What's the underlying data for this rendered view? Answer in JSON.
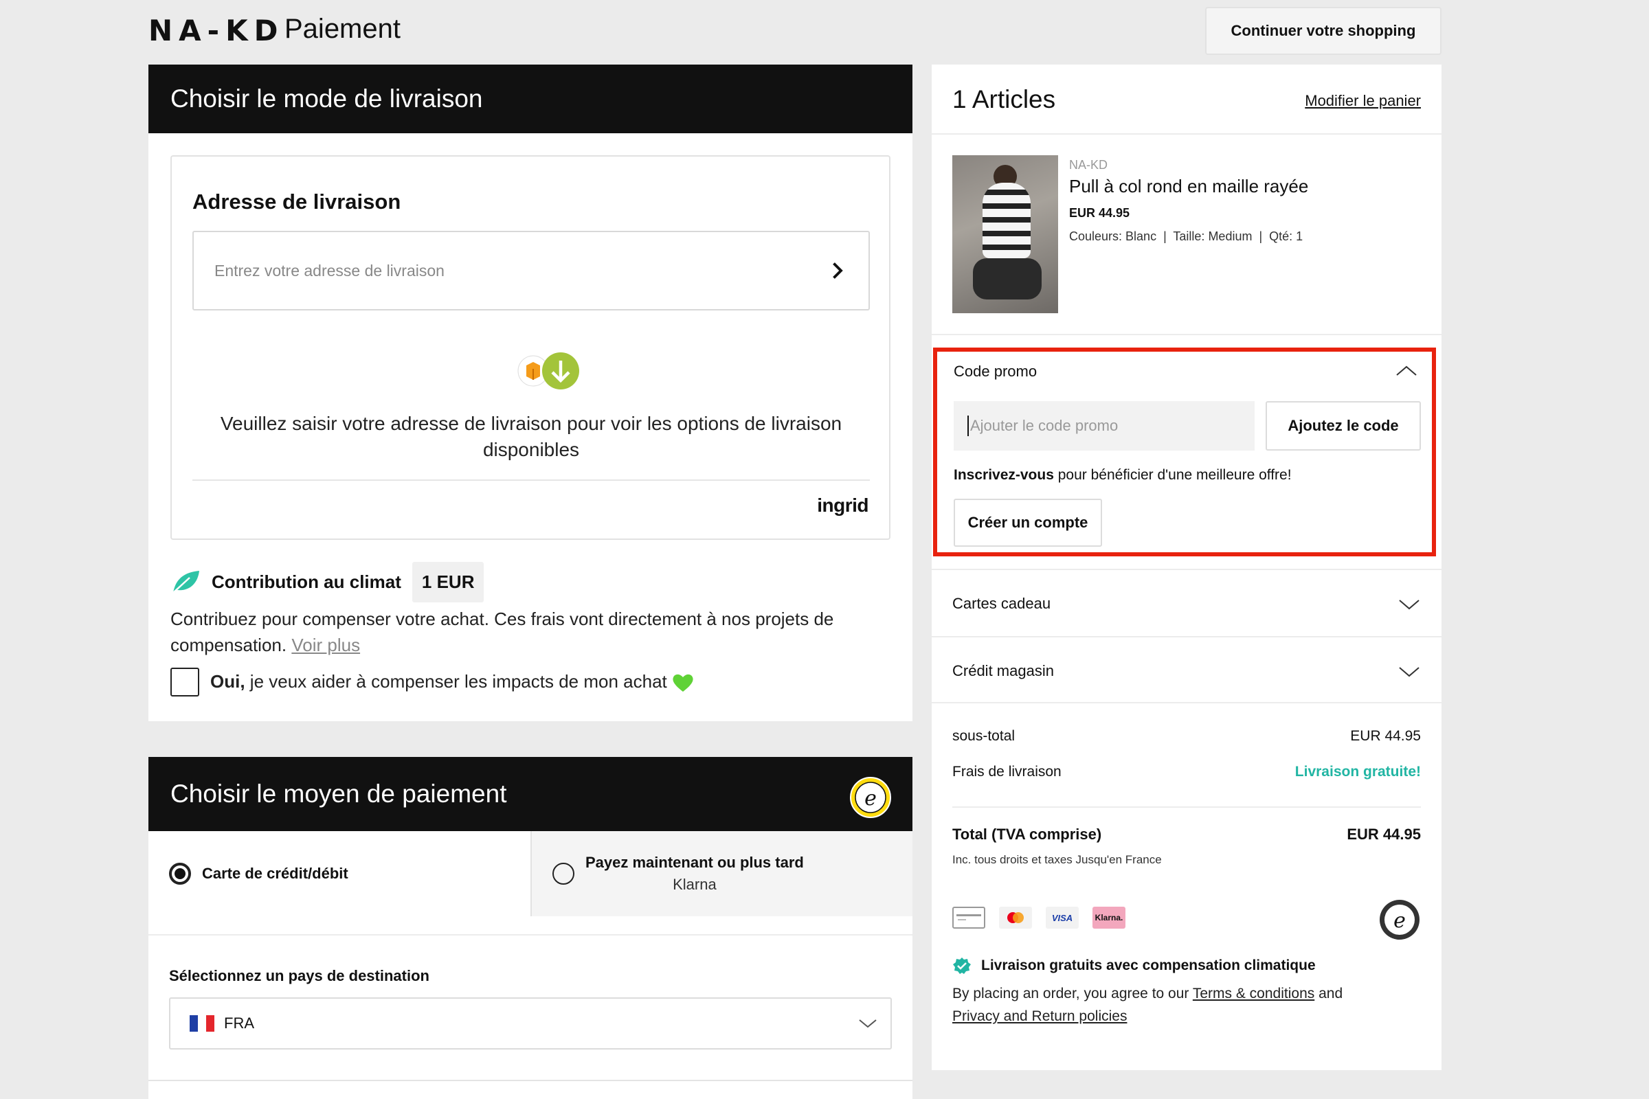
{
  "header": {
    "logo": "NA-KD",
    "title": "Paiement",
    "continue_label": "Continuer votre shopping"
  },
  "delivery": {
    "heading": "Choisir le mode de livraison",
    "address_title": "Adresse de livraison",
    "address_placeholder": "Entrez votre adresse de livraison",
    "message": "Veuillez saisir votre adresse de livraison pour voir les options de livraison disponibles",
    "provider": "ingrid"
  },
  "climate": {
    "title": "Contribution au climat",
    "amount": "1 EUR",
    "text": "Contribuez pour compenser votre achat. Ces frais vont directement à nos projets de compensation.",
    "more_link": "Voir plus",
    "checkbox_bold": "Oui,",
    "checkbox_label": " je veux aider à compenser les impacts de mon achat"
  },
  "payment": {
    "heading": "Choisir le moyen de paiement",
    "tabs": [
      {
        "label": "Carte de crédit/débit",
        "selected": true
      },
      {
        "label": "Payez maintenant ou plus tard",
        "sub": "Klarna",
        "selected": false
      }
    ],
    "country_label": "Sélectionnez un pays de destination",
    "country_value": "FRA"
  },
  "cart": {
    "heading": "1 Articles",
    "edit_link": "Modifier le panier",
    "item": {
      "brand": "NA-KD",
      "name": "Pull à col rond en maille rayée",
      "price": "EUR 44.95",
      "meta": "Couleurs: Blanc  |  Taille: Medium  |  Qté: 1"
    },
    "promo": {
      "title": "Code promo",
      "placeholder": "Ajouter le code promo",
      "add_label": "Ajoutez le code",
      "signup_bold": "Inscrivez-vous",
      "signup_text": " pour bénéficier d'une meilleure offre!",
      "create_label": "Créer un compte"
    },
    "gift_cards": "Cartes cadeau",
    "store_credit": "Crédit magasin",
    "summary": {
      "subtotal_label": "sous-total",
      "subtotal_value": "EUR 44.95",
      "shipping_label": "Frais de livraison",
      "shipping_value": "Livraison gratuite!",
      "total_label": "Total (TVA comprise)",
      "total_value": "EUR 44.95",
      "note": "Inc. tous droits et taxes Jusqu'en France"
    },
    "payment_icons": [
      "card-icon",
      "mastercard-icon",
      "visa-icon",
      "klarna-icon"
    ],
    "visa_text": "VISA",
    "klarna_text": "Klarna.",
    "climate_shipping": "Livraison gratuits avec compensation climatique",
    "legal": {
      "pre": "By placing an order, you agree to our ",
      "terms": "Terms & conditions",
      "mid": " and ",
      "privacy": "Privacy and Return policies"
    }
  },
  "colors": {
    "accent_red": "#e8220e",
    "free_ship": "#21b5a3",
    "dark": "#111111"
  }
}
